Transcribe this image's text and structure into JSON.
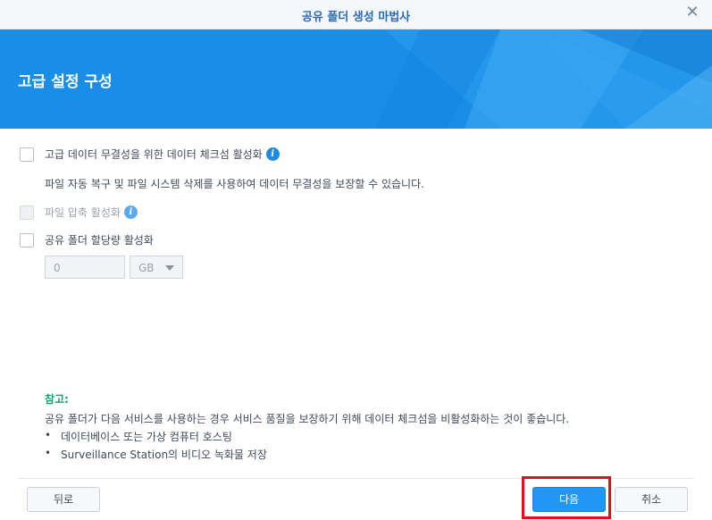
{
  "window": {
    "title": "공유 폴더 생성 마법사",
    "close_icon": "close-icon"
  },
  "banner": {
    "heading": "고급 설정 구성",
    "accent_color": "#1a8ee6"
  },
  "options": {
    "checksum": {
      "label": "고급 데이터 무결성을 위한 데이터 체크섬 활성화",
      "checked": false,
      "description": "파일 자동 복구 및 파일 시스템 삭제를 사용하여 데이터 무결성을 보장할 수 있습니다."
    },
    "compression": {
      "label": "파일 압축 활성화",
      "checked": false,
      "disabled": true
    },
    "quota": {
      "label": "공유 폴더 할당량 활성화",
      "checked": false,
      "value_placeholder": "0",
      "unit": "GB"
    }
  },
  "note": {
    "title": "참고:",
    "text": "공유 폴더가 다음 서비스를 사용하는 경우 서비스 품질을 보장하기 위해 데이터 체크섬을 비활성화하는 것이 좋습니다.",
    "items": [
      "데이터베이스 또는 가상 컴퓨터 호스팅",
      "Surveillance Station의 비디오 녹화물 저장"
    ]
  },
  "footer": {
    "back_label": "뒤로",
    "next_label": "다음",
    "cancel_label": "취소",
    "highlight_color": "#e0101a"
  }
}
